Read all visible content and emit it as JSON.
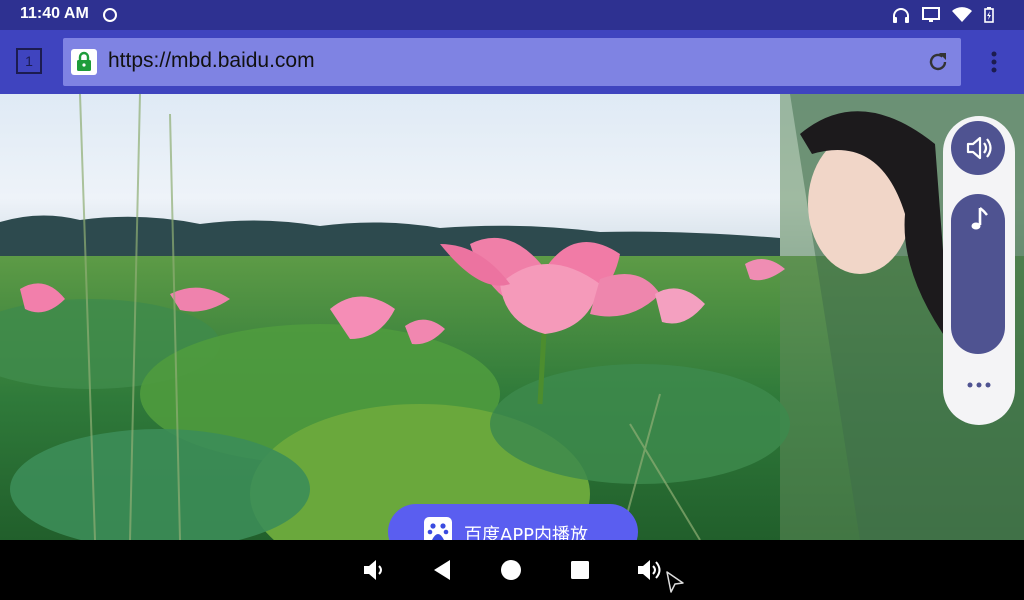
{
  "status_bar": {
    "time": "11:40 AM",
    "icons": [
      "clock-icon",
      "headphones-icon",
      "cast-icon",
      "wifi-icon",
      "battery-icon"
    ]
  },
  "browser": {
    "tab_count": "1",
    "url": "https://mbd.baidu.com",
    "icons": [
      "lock-icon",
      "reload-icon",
      "menu-icon"
    ]
  },
  "video": {
    "side_controls": [
      "volume-icon",
      "music-note-icon",
      "more-icon"
    ],
    "app_button_label": "百度APP内播放"
  },
  "nav_bar": {
    "buttons": [
      "volume-down-icon",
      "back-icon",
      "home-icon",
      "recents-icon",
      "volume-up-icon"
    ]
  },
  "colors": {
    "status_bar": "#2e3191",
    "toolbar": "#3f44bf",
    "url_bar": "#7f83e3",
    "side_panel_control": "#4f5391",
    "app_button": "#5a5ef0"
  }
}
